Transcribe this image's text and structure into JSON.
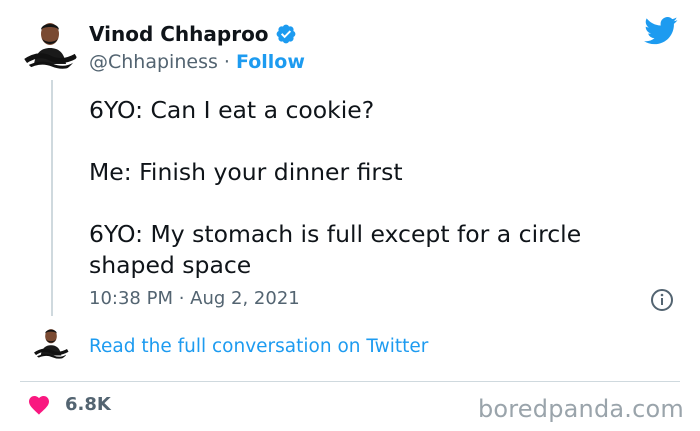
{
  "tweet": {
    "author_name": "Vinod Chhaproo",
    "handle": "@Chhapiness",
    "separator": "·",
    "follow_label": "Follow",
    "lines": [
      "6YO: Can I eat a cookie?",
      "Me: Finish your dinner first",
      "6YO: My stomach is full except for a circle shaped space"
    ],
    "timestamp": "10:38 PM · Aug 2, 2021",
    "read_more_label": "Read the full conversation on Twitter",
    "like_count": "6.8K"
  },
  "icons": {
    "verified": "verified-badge-icon",
    "brand": "twitter-bird-icon",
    "info": "info-icon",
    "like": "heart-icon"
  },
  "colors": {
    "accent": "#1d9bf0",
    "heart": "#f91880",
    "text": "#0f1419",
    "muted": "#536471"
  },
  "watermark": "boredpanda.com"
}
